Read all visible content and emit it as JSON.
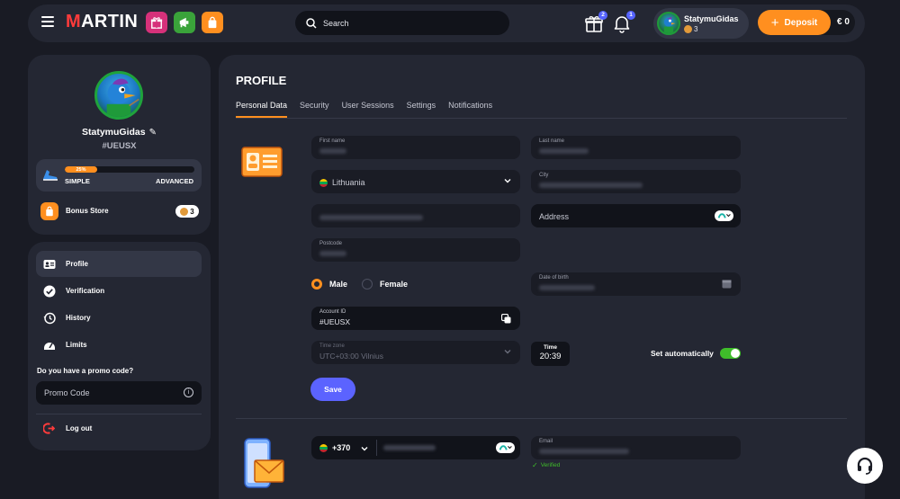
{
  "header": {
    "logo": "MARTIN",
    "search_placeholder": "Search",
    "gift_badge": "2",
    "notification_badge": "1",
    "username": "StatymuGidas",
    "user_coins": "3",
    "deposit_label": "Deposit",
    "balance": "€ 0"
  },
  "sidebar": {
    "username": "StatymuGidas",
    "user_tag": "#UEUSX",
    "level_progress_label": "25%",
    "level_progress": 25,
    "level_current": "SIMPLE",
    "level_next": "ADVANCED",
    "bonus_store_label": "Bonus Store",
    "bonus_count": "3",
    "nav": [
      {
        "label": "Profile"
      },
      {
        "label": "Verification"
      },
      {
        "label": "History"
      },
      {
        "label": "Limits"
      }
    ],
    "promo_question": "Do you have a promo code?",
    "promo_placeholder": "Promo Code",
    "logout_label": "Log out"
  },
  "main": {
    "title": "PROFILE",
    "tabs": [
      {
        "label": "Personal Data"
      },
      {
        "label": "Security"
      },
      {
        "label": "User Sessions"
      },
      {
        "label": "Settings"
      },
      {
        "label": "Notifications"
      }
    ],
    "form": {
      "first_name_label": "First name",
      "last_name_label": "Last name",
      "country": "Lithuania",
      "city_label": "City",
      "address_placeholder": "Address",
      "postcode_label": "Postcode",
      "gender_male": "Male",
      "gender_female": "Female",
      "dob_label": "Date of birth",
      "account_id_label": "Account ID",
      "account_id": "#UEUSX",
      "timezone_label": "Time zone",
      "timezone_value": "UTC+03:00 Vilnius",
      "time_label": "Time",
      "time_value": "20:39",
      "set_auto_label": "Set automatically",
      "save_label": "Save"
    },
    "contact": {
      "phone_code": "+370",
      "email_label": "Email",
      "verified_label": "Verified"
    }
  },
  "colors": {
    "accent": "#ff8f1f",
    "primary_button": "#5b63ff",
    "success": "#3fbd2a",
    "background": "#191b24",
    "panel": "#242733"
  }
}
